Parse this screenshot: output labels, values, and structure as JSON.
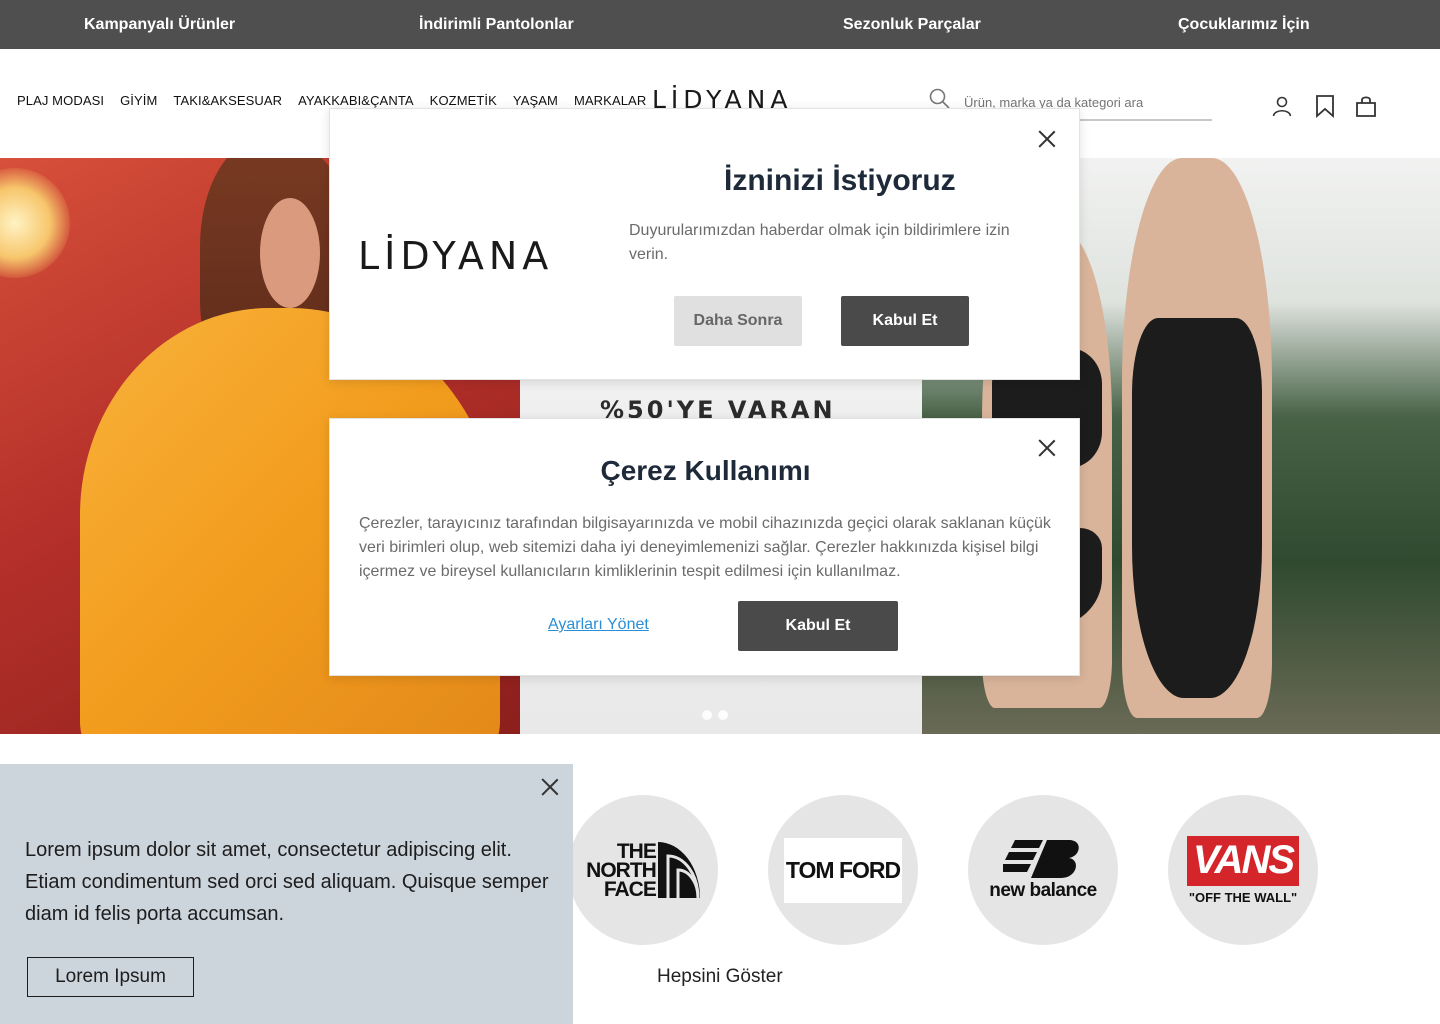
{
  "topbar": {
    "links": [
      "Kampanyalı Ürünler",
      "İndirimli Pantolonlar",
      "Sezonluk Parçalar",
      "Çocuklarımız İçin"
    ]
  },
  "header": {
    "nav": [
      "PLAJ MODASI",
      "GİYİM",
      "TAKI&AKSESUAR",
      "AYAKKABI&ÇANTA",
      "KOZMETİK",
      "YAŞAM",
      "MARKALAR"
    ],
    "logo": "LİDYANA",
    "search_placeholder": "Ürün, marka ya da kategori ara",
    "icons": [
      "user-icon",
      "bookmark-icon",
      "bag-icon"
    ]
  },
  "hero": {
    "banner_text": "%50'YE VARAN",
    "slide_count": 2
  },
  "notification_modal": {
    "logo": "LİDYANA",
    "title": "İzninizi İstiyoruz",
    "body": "Duyurularımızdan haberdar olmak için bildirimlere izin verin.",
    "later_label": "Daha Sonra",
    "accept_label": "Kabul Et"
  },
  "cookie_modal": {
    "title": "Çerez Kullanımı",
    "body": "Çerezler, tarayıcınız tarafından bilgisayarınızda ve mobil cihazınızda geçici olarak saklanan küçük veri birimleri olup, web sitemizi daha iyi deneyimlemenizi sağlar. Çerezler hakkınızda kişisel bilgi içermez ve bireysel kullanıcıların kimliklerinin tespit edilmesi için kullanılmaz.",
    "manage_label": "Ayarları Yönet",
    "accept_label": "Kabul Et"
  },
  "brands": {
    "items": [
      "THE NORTH FACE",
      "TOM FORD",
      "new balance",
      "VANS"
    ],
    "vans_tagline": "\"OFF THE WALL\"",
    "show_all": "Hepsini Göster"
  },
  "promo": {
    "text": "Lorem ipsum dolor sit amet, consectetur adipiscing elit. Etiam condimentum sed orci sed aliquam. Quisque semper diam id felis porta accumsan.",
    "button": "Lorem Ipsum"
  },
  "colors": {
    "topbar": "#4f4f4f",
    "button_dark": "#4a4a4a",
    "link_blue": "#2a8fd6",
    "promo_bg": "#ccd4dc",
    "vans_red": "#d4252b"
  }
}
